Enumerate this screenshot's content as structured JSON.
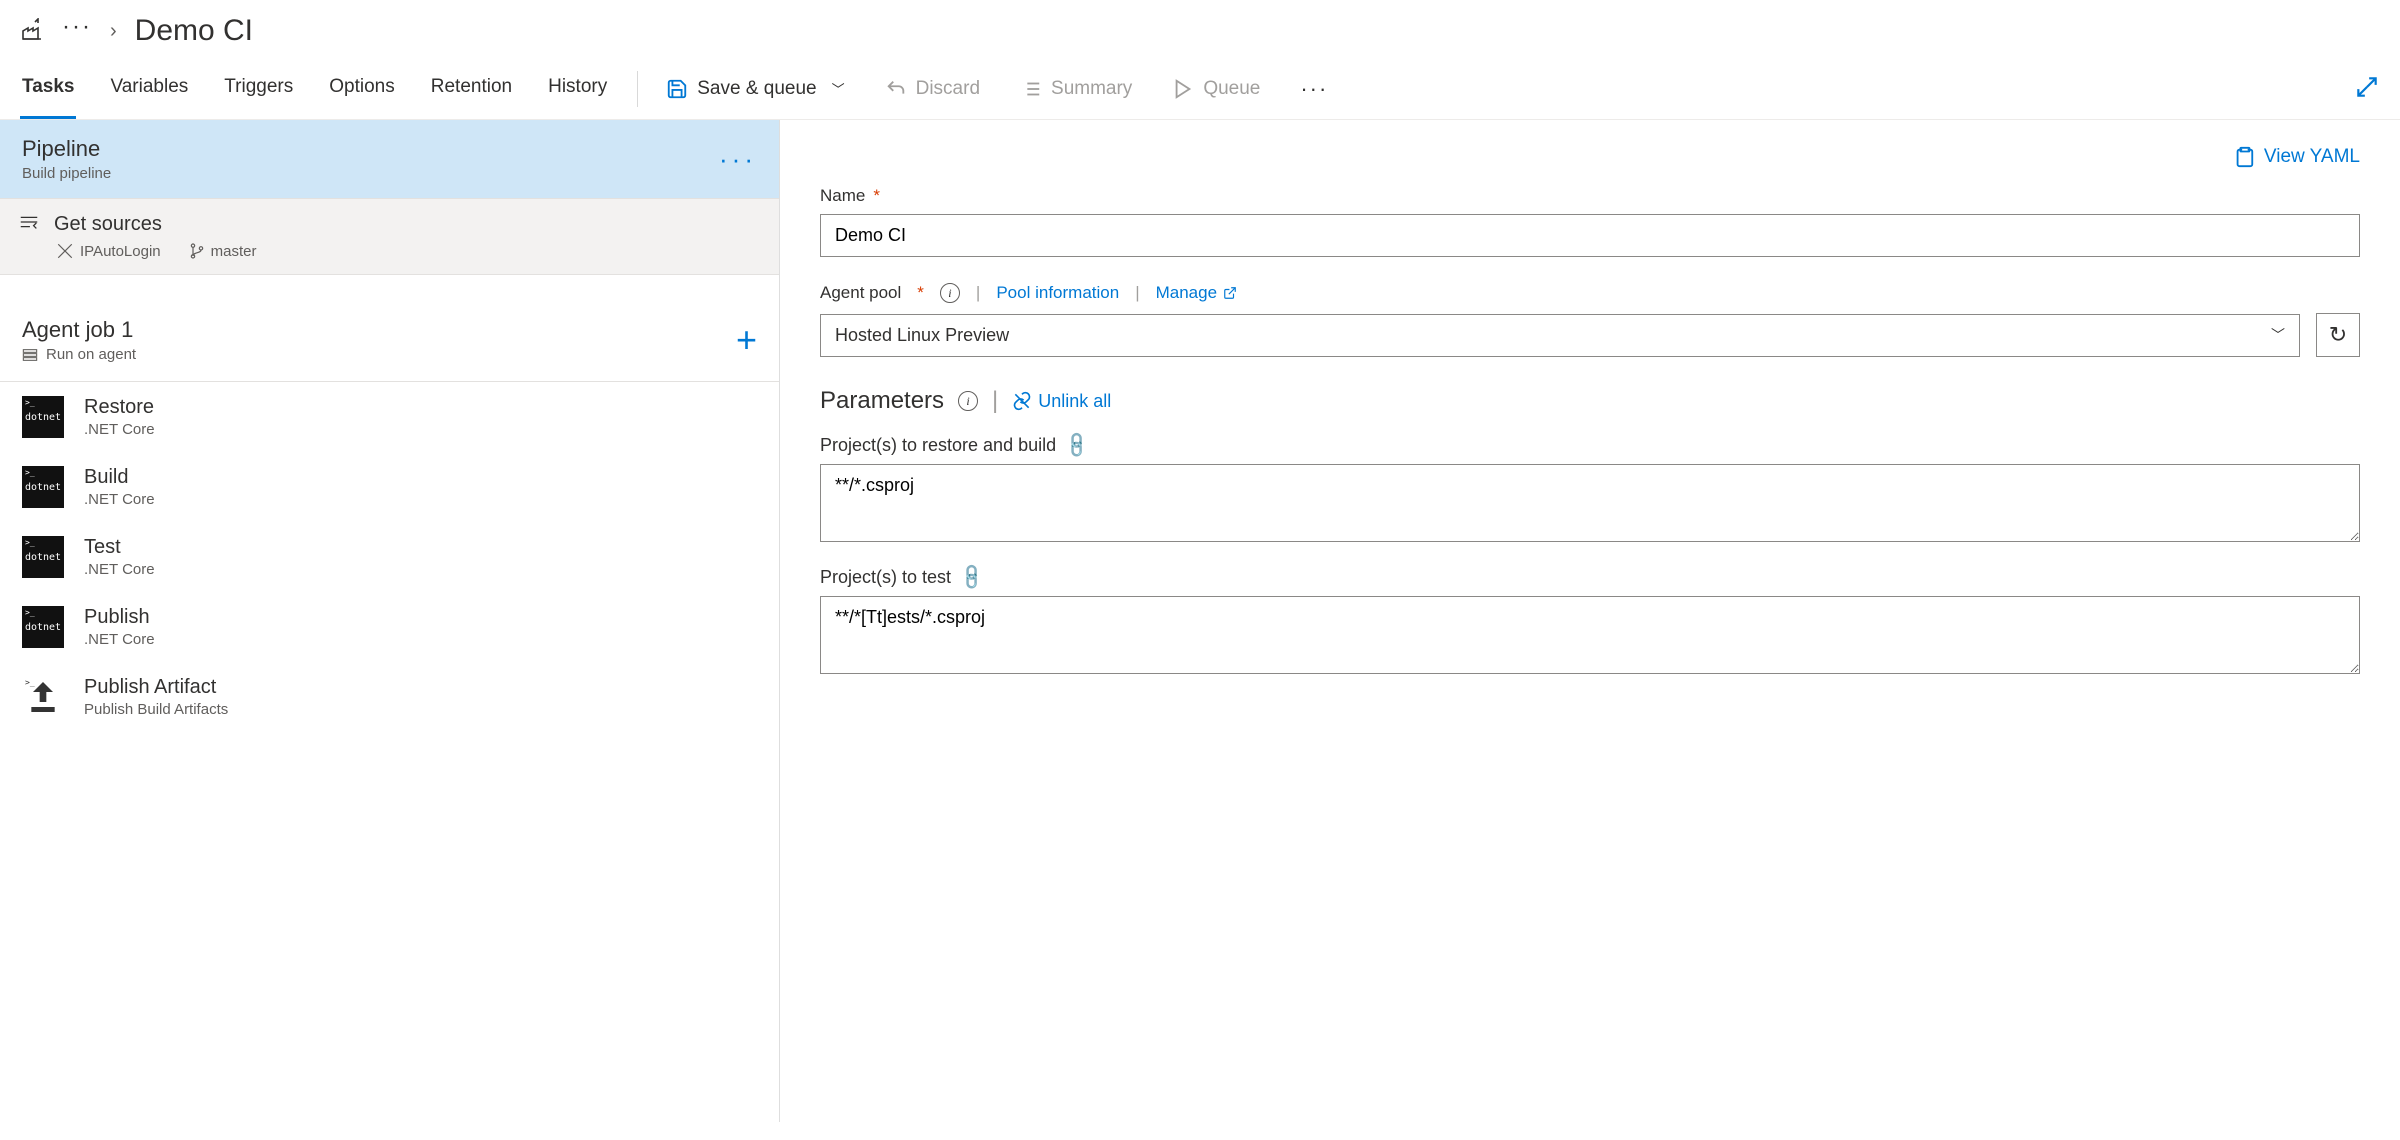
{
  "breadcrumb": {
    "title": "Demo CI"
  },
  "tabs": [
    "Tasks",
    "Variables",
    "Triggers",
    "Options",
    "Retention",
    "History"
  ],
  "activeTab": 0,
  "toolbar": {
    "save": "Save & queue",
    "discard": "Discard",
    "summary": "Summary",
    "queue": "Queue"
  },
  "pipeline": {
    "title": "Pipeline",
    "sub": "Build pipeline"
  },
  "getSources": {
    "title": "Get sources",
    "repo": "IPAutoLogin",
    "branch": "master"
  },
  "agentJob": {
    "title": "Agent job 1",
    "sub": "Run on agent"
  },
  "tasks": [
    {
      "title": "Restore",
      "sub": ".NET Core",
      "icon": "dotnet"
    },
    {
      "title": "Build",
      "sub": ".NET Core",
      "icon": "dotnet"
    },
    {
      "title": "Test",
      "sub": ".NET Core",
      "icon": "dotnet"
    },
    {
      "title": "Publish",
      "sub": ".NET Core",
      "icon": "dotnet"
    },
    {
      "title": "Publish Artifact",
      "sub": "Publish Build Artifacts",
      "icon": "upload"
    }
  ],
  "right": {
    "viewYaml": "View YAML",
    "nameLabel": "Name",
    "nameValue": "Demo CI",
    "agentPoolLabel": "Agent pool",
    "poolInfo": "Pool information",
    "manage": "Manage",
    "agentPoolValue": "Hosted Linux Preview",
    "parameters": "Parameters",
    "unlinkAll": "Unlink all",
    "projectsRestoreLabel": "Project(s) to restore and build",
    "projectsRestoreValue": "**/*.csproj",
    "projectsTestLabel": "Project(s) to test",
    "projectsTestValue": "**/*[Tt]ests/*.csproj"
  }
}
